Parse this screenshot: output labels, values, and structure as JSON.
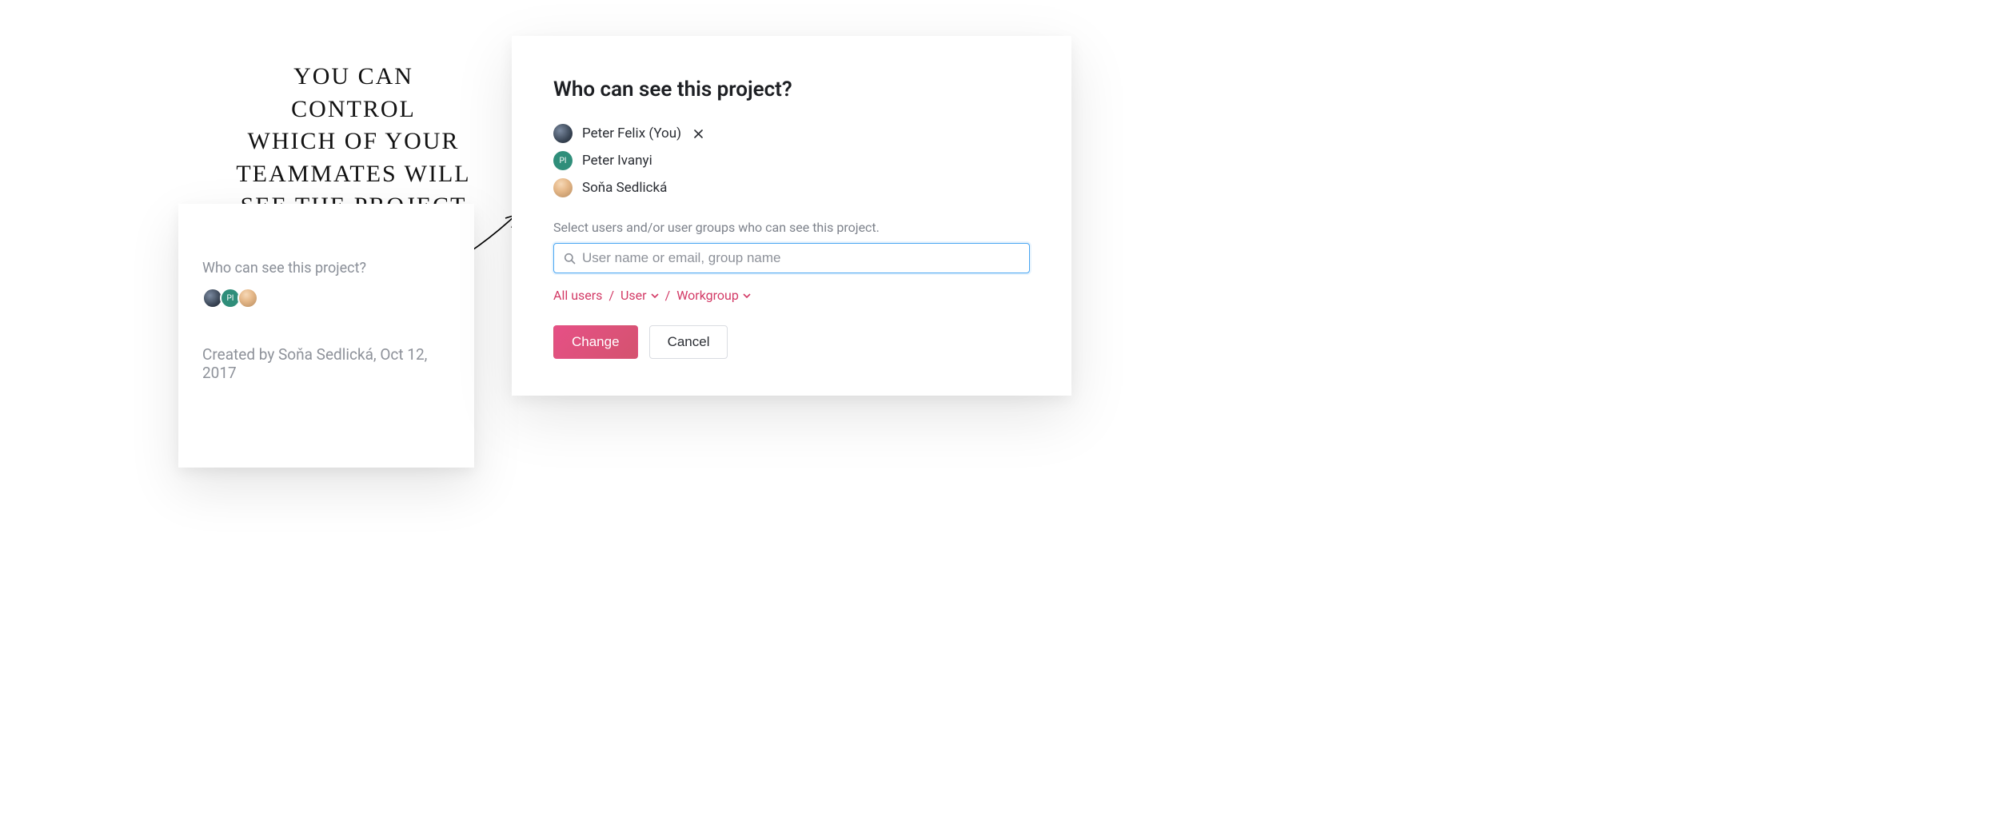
{
  "annotation": "You can control\nwhich of your\nteammates will\nsee the project",
  "summary_card": {
    "question": "Who can see this project?",
    "created_by_text": "Created by Soňa Sedlická, Oct 12, 2017",
    "avatars": [
      {
        "initials": "",
        "style": "av-a",
        "name": "Peter Felix"
      },
      {
        "initials": "PI",
        "style": "av-b",
        "name": "Peter Ivanyi"
      },
      {
        "initials": "",
        "style": "av-c",
        "name": "Soňa Sedlická"
      }
    ]
  },
  "dialog": {
    "title": "Who can see this project?",
    "members": [
      {
        "label": "Peter Felix (You)",
        "initials": "",
        "style": "av-a",
        "removable": true
      },
      {
        "label": "Peter Ivanyi",
        "initials": "PI",
        "style": "av-b",
        "removable": false
      },
      {
        "label": "Soňa Sedlická",
        "initials": "",
        "style": "av-c",
        "removable": false
      }
    ],
    "helper_text": "Select users and/or user groups who can see this project.",
    "search_placeholder": "User name or email, group name",
    "filters": {
      "all_users": "All users",
      "user": "User",
      "workgroup": "Workgroup"
    },
    "separator": "/",
    "buttons": {
      "change": "Change",
      "cancel": "Cancel"
    }
  },
  "colors": {
    "accent_pink": "#d33a66",
    "focus_blue": "#4aa6f2",
    "muted_text": "#8d9199"
  }
}
